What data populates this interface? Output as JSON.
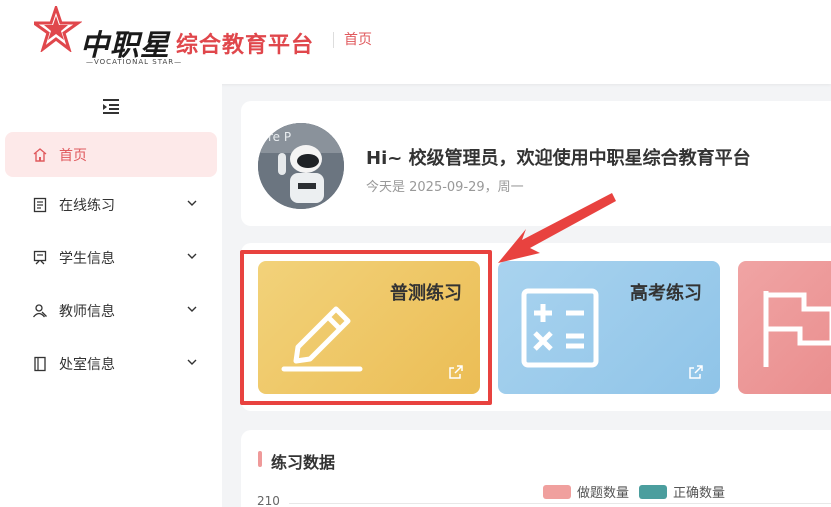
{
  "header": {
    "logo_main": "中职星",
    "logo_sub": "综合教育平台",
    "logo_tag": "—VOCATIONAL STAR—",
    "breadcrumb": "首页"
  },
  "sidebar": {
    "items": [
      {
        "label": "首页",
        "icon": "home-icon",
        "active": true
      },
      {
        "label": "在线练习",
        "icon": "document-icon"
      },
      {
        "label": "学生信息",
        "icon": "student-icon"
      },
      {
        "label": "教师信息",
        "icon": "teacher-icon"
      },
      {
        "label": "处室信息",
        "icon": "office-icon"
      }
    ]
  },
  "welcome": {
    "title": "Hi~ 校级管理员，欢迎使用中职星综合教育平台",
    "date": "今天是 2025-09-29，周一"
  },
  "cards": [
    {
      "title": "普测练习",
      "icon": "pencil-icon",
      "color": "#ebbd55"
    },
    {
      "title": "高考练习",
      "icon": "calculator-icon",
      "color": "#8fc4e8"
    },
    {
      "title": "",
      "icon": "flag-icon",
      "color": "#e98c8c"
    }
  ],
  "stats": {
    "title": "练习数据",
    "legend": [
      {
        "name": "做题数量",
        "color": "#f0a09e"
      },
      {
        "name": "正确数量",
        "color": "#4b9e9e"
      }
    ],
    "y_top": "210"
  },
  "colors": {
    "accent": "#e05a5e",
    "highlight": "#e8423f"
  }
}
